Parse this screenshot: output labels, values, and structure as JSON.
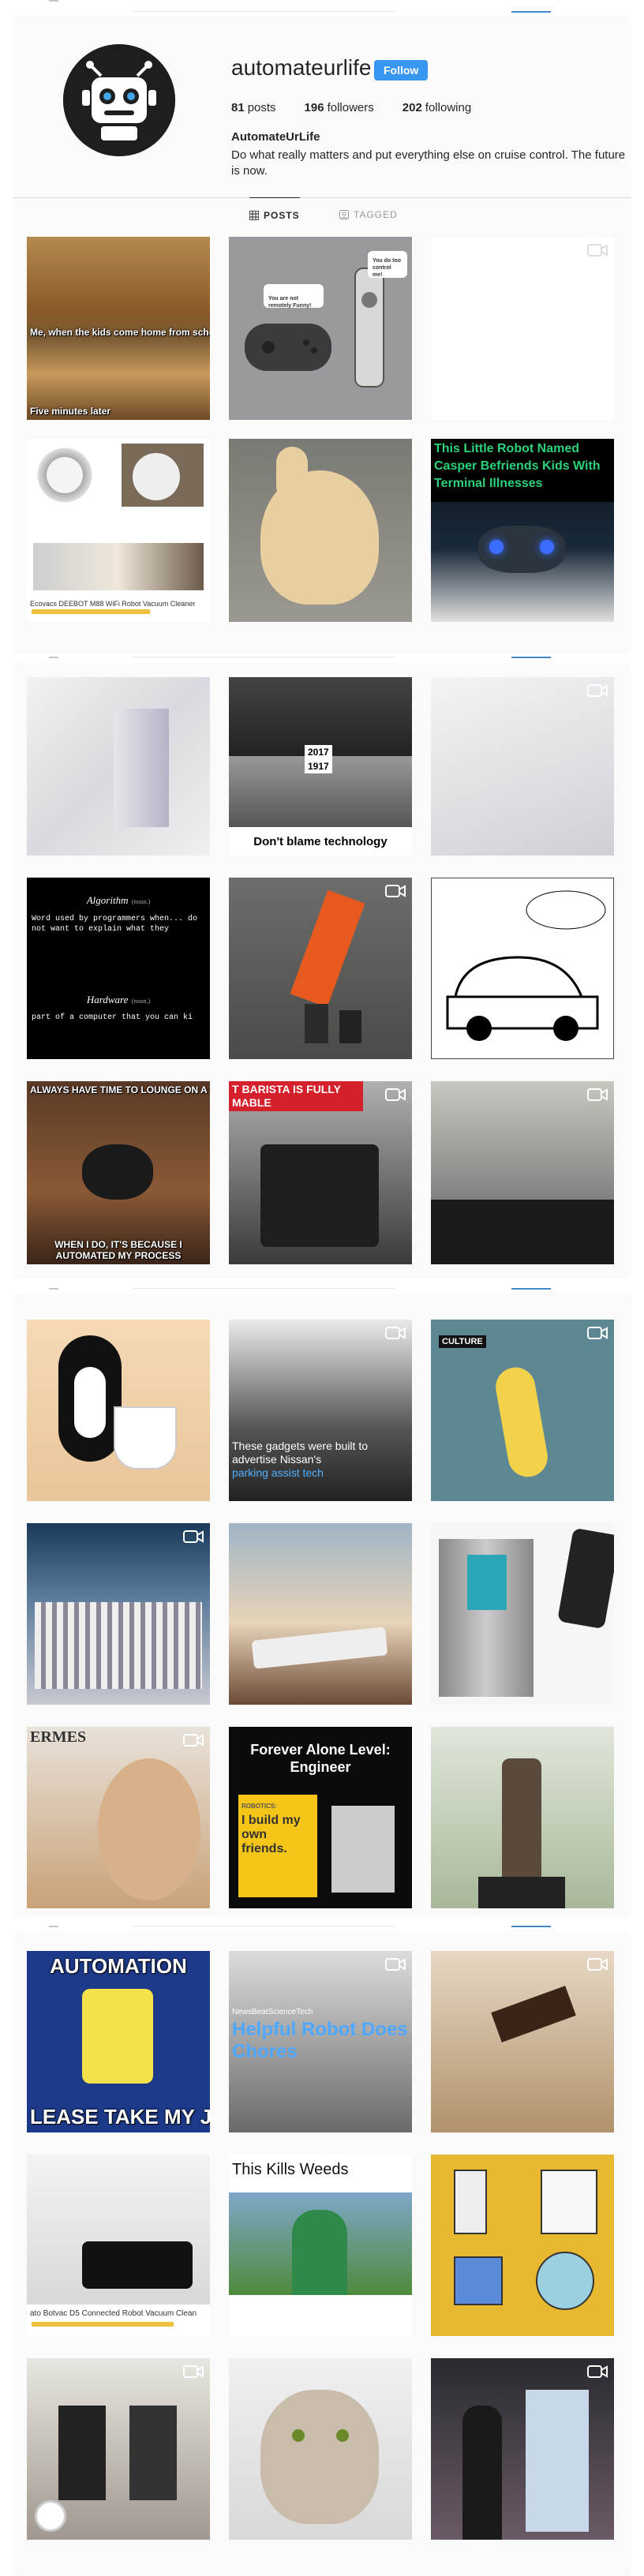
{
  "profile": {
    "username": "automateurlife",
    "follow_label": "Follow",
    "posts_count": "81",
    "posts_label": "posts",
    "followers_count": "196",
    "followers_label": "followers",
    "following_count": "202",
    "following_label": "following",
    "full_name": "AutomateUrLife",
    "bio": "Do what really matters and put everything else on cruise control. The future is now."
  },
  "tabs": [
    {
      "label": "Posts",
      "active": true,
      "icon": "grid-icon"
    },
    {
      "label": "Tagged",
      "active": false,
      "icon": "tag-icon"
    }
  ],
  "posts": [
    {
      "captions": [
        "Me, when the kids come home from school.",
        "Five minutes later"
      ]
    },
    {
      "captions": [
        "You are not remotely Funny!",
        "You do too control me!"
      ]
    },
    {
      "captions": [],
      "video": true
    },
    {
      "captions": [
        "Ecovacs DEEBOT M88 WiFi Robot Vacuum Cleaner"
      ]
    },
    {
      "captions": []
    },
    {
      "captions": [
        "This Little Robot Named Casper Befriends Kids With Terminal Illnesses"
      ]
    },
    {
      "captions": []
    },
    {
      "captions": [
        "2017",
        "1917",
        "Don't blame technology"
      ]
    },
    {
      "captions": [],
      "video": true
    },
    {
      "captions": [
        "Algorithm",
        "(noun.)",
        "Word used by programmers when... do not want to explain what they",
        "Hardware",
        "(noun.)",
        "part of a computer that you can ki"
      ]
    },
    {
      "captions": [],
      "video": true
    },
    {
      "captions": []
    },
    {
      "captions": [
        "ALWAYS HAVE TIME TO LOUNGE ON A WOOD",
        "WHEN I DO, IT'S BECAUSE I AUTOMATED MY PROCESS"
      ]
    },
    {
      "captions": [
        "T BARISTA IS FULLY MABLE"
      ],
      "video": true
    },
    {
      "captions": [],
      "video": true
    },
    {
      "captions": []
    },
    {
      "captions": [
        "These gadgets were built to advertise Nissan's",
        "parking assist tech"
      ],
      "video": true
    },
    {
      "captions": [
        "CULTURE"
      ],
      "video": true
    },
    {
      "captions": [],
      "video": true
    },
    {
      "captions": []
    },
    {
      "captions": []
    },
    {
      "captions": [
        "ERMES"
      ],
      "video": true
    },
    {
      "captions": [
        "Forever Alone Level: Engineer",
        "ROBOTICS:",
        "I build my own friends."
      ]
    },
    {
      "captions": []
    },
    {
      "captions": [
        "AUTOMATION",
        "LEASE TAKE MY JO"
      ]
    },
    {
      "captions": [
        "NewsBeatScienceTech",
        "Helpful Robot Does Chores"
      ],
      "video": true
    },
    {
      "captions": [],
      "video": true
    },
    {
      "captions": [
        "ato Botvac D5 Connected Robot Vacuum Clean"
      ]
    },
    {
      "captions": [
        "This Kills Weeds"
      ]
    },
    {
      "captions": []
    },
    {
      "captions": [],
      "video": true
    },
    {
      "captions": []
    },
    {
      "captions": [],
      "video": true
    }
  ]
}
